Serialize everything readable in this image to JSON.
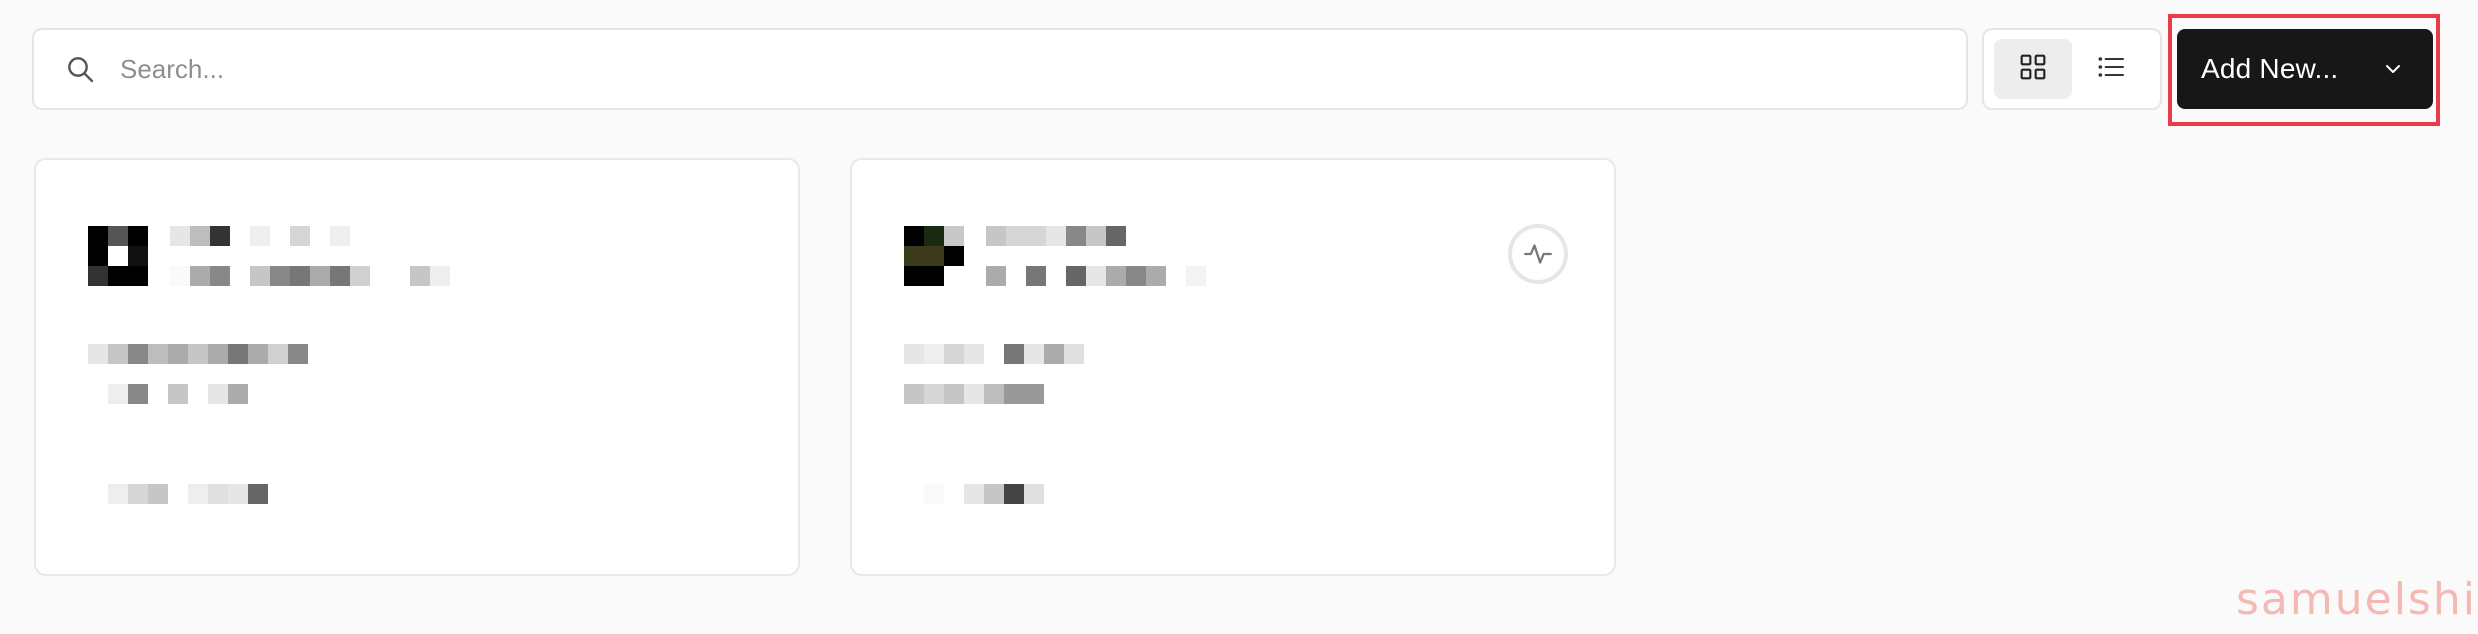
{
  "search": {
    "placeholder": "Search..."
  },
  "view_toggle": {
    "active": "grid"
  },
  "add_new": {
    "label": "Add New..."
  },
  "projects": [
    {
      "logo": "redacted-logo",
      "name": "",
      "url": "",
      "commit": "",
      "branch": "",
      "updated": ""
    },
    {
      "logo": "redacted-logo",
      "name": "",
      "url": "",
      "commit": "",
      "branch": "",
      "updated": "",
      "status_icon": "activity-icon"
    }
  ],
  "watermark": "samuelshi",
  "colors": {
    "background": "#fafafa",
    "primary_button": "#171717",
    "highlight": "#ea3b4b"
  }
}
